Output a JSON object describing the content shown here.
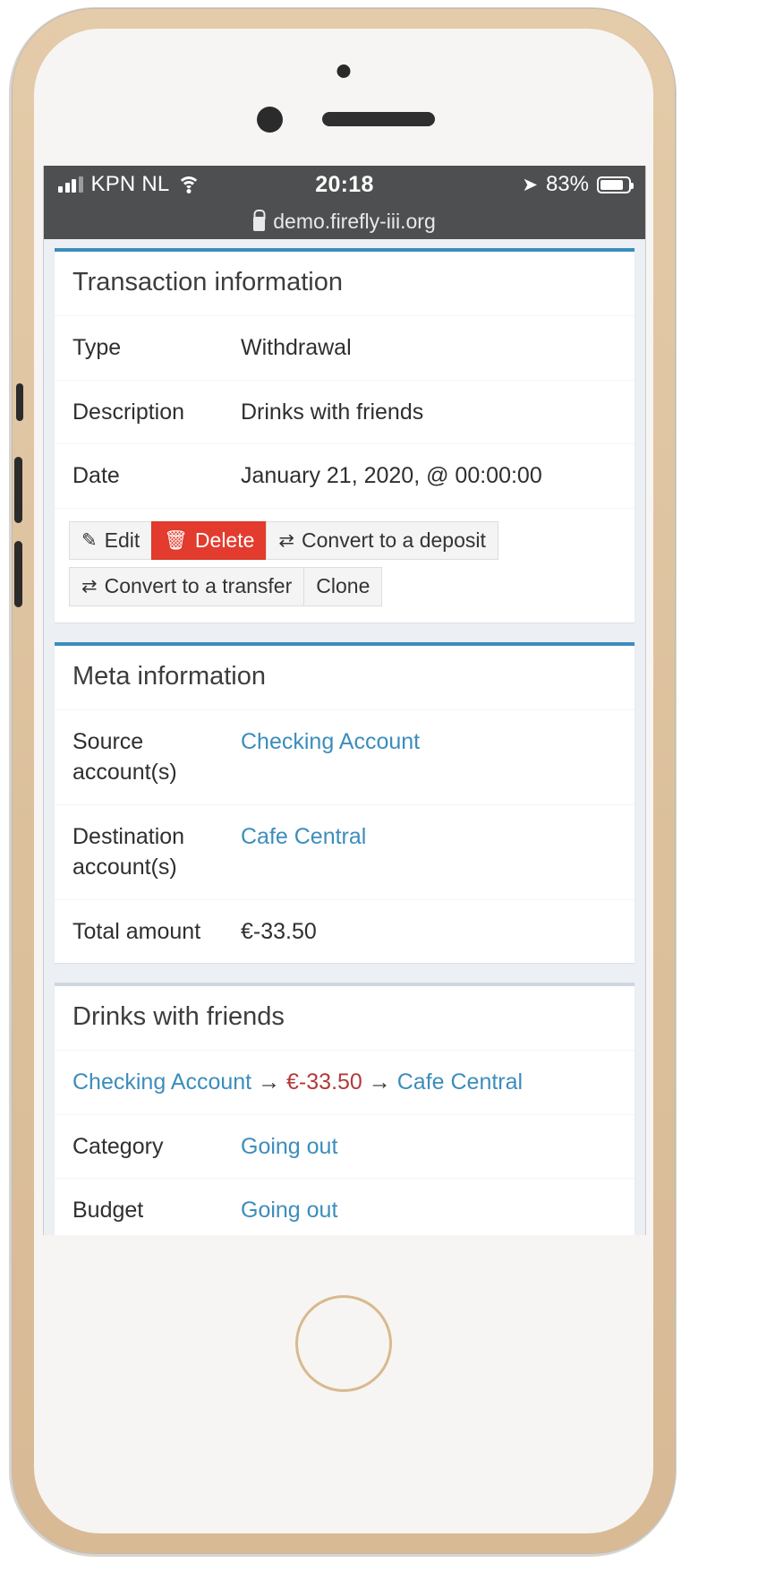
{
  "status_bar": {
    "carrier": "KPN NL",
    "time": "20:18",
    "battery_percent": "83%",
    "location_icon": "location-arrow-icon",
    "wifi_icon": "wifi-icon",
    "signal_icon": "cellular-signal-icon",
    "battery_icon": "battery-icon"
  },
  "browser": {
    "url": "demo.firefly-iii.org",
    "lock_icon": "lock-icon"
  },
  "cards": {
    "transaction": {
      "title": "Transaction information",
      "rows": [
        {
          "label": "Type",
          "value": "Withdrawal"
        },
        {
          "label": "Description",
          "value": "Drinks with friends"
        },
        {
          "label": "Date",
          "value": "January 21, 2020, @ 00:00:00"
        }
      ],
      "buttons": {
        "edit": "Edit",
        "delete": "Delete",
        "convert_deposit": "Convert to a deposit",
        "convert_transfer": "Convert to a transfer",
        "clone": "Clone"
      },
      "icons": {
        "edit": "pencil-icon",
        "delete": "trash-icon",
        "convert": "exchange-arrows-icon"
      }
    },
    "meta": {
      "title": "Meta information",
      "rows": [
        {
          "label": "Source account(s)",
          "value": "Checking Account",
          "link": true
        },
        {
          "label": "Destination account(s)",
          "value": "Cafe Central",
          "link": true
        },
        {
          "label": "Total amount",
          "value": "€-33.50",
          "negative": true
        }
      ]
    },
    "split": {
      "title": "Drinks with friends",
      "flow": {
        "source": "Checking Account",
        "amount": "€-33.50",
        "destination": "Cafe Central",
        "arrow": "→"
      },
      "rows": [
        {
          "label": "Category",
          "value": "Going out",
          "link": true
        },
        {
          "label": "Budget",
          "value": "Going out",
          "link": true
        }
      ]
    }
  },
  "colors": {
    "accent": "#3c8dbc",
    "danger": "#e33b2e",
    "negative_amount": "#b33a3a",
    "page_bg": "#ecf0f5",
    "status_bar_bg": "#4d4f50",
    "device_bezel": "#e2c9a8"
  }
}
